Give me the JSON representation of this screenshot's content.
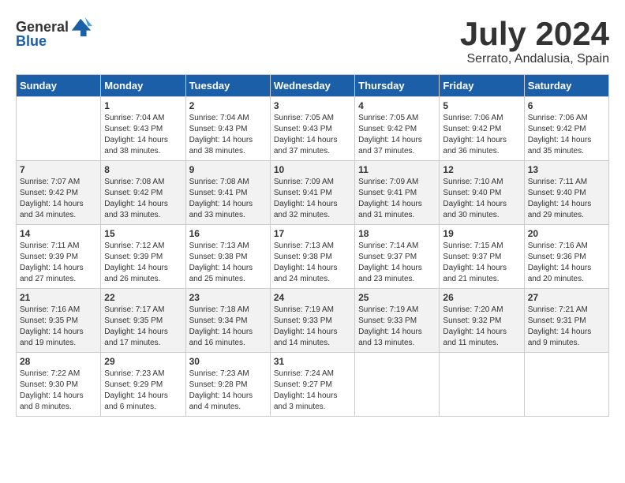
{
  "header": {
    "logo_general": "General",
    "logo_blue": "Blue",
    "month_year": "July 2024",
    "location": "Serrato, Andalusia, Spain"
  },
  "days_of_week": [
    "Sunday",
    "Monday",
    "Tuesday",
    "Wednesday",
    "Thursday",
    "Friday",
    "Saturday"
  ],
  "weeks": [
    [
      {
        "day": "",
        "sunrise": "",
        "sunset": "",
        "daylight": ""
      },
      {
        "day": "1",
        "sunrise": "Sunrise: 7:04 AM",
        "sunset": "Sunset: 9:43 PM",
        "daylight": "Daylight: 14 hours and 38 minutes."
      },
      {
        "day": "2",
        "sunrise": "Sunrise: 7:04 AM",
        "sunset": "Sunset: 9:43 PM",
        "daylight": "Daylight: 14 hours and 38 minutes."
      },
      {
        "day": "3",
        "sunrise": "Sunrise: 7:05 AM",
        "sunset": "Sunset: 9:43 PM",
        "daylight": "Daylight: 14 hours and 37 minutes."
      },
      {
        "day": "4",
        "sunrise": "Sunrise: 7:05 AM",
        "sunset": "Sunset: 9:42 PM",
        "daylight": "Daylight: 14 hours and 37 minutes."
      },
      {
        "day": "5",
        "sunrise": "Sunrise: 7:06 AM",
        "sunset": "Sunset: 9:42 PM",
        "daylight": "Daylight: 14 hours and 36 minutes."
      },
      {
        "day": "6",
        "sunrise": "Sunrise: 7:06 AM",
        "sunset": "Sunset: 9:42 PM",
        "daylight": "Daylight: 14 hours and 35 minutes."
      }
    ],
    [
      {
        "day": "7",
        "sunrise": "Sunrise: 7:07 AM",
        "sunset": "Sunset: 9:42 PM",
        "daylight": "Daylight: 14 hours and 34 minutes."
      },
      {
        "day": "8",
        "sunrise": "Sunrise: 7:08 AM",
        "sunset": "Sunset: 9:42 PM",
        "daylight": "Daylight: 14 hours and 33 minutes."
      },
      {
        "day": "9",
        "sunrise": "Sunrise: 7:08 AM",
        "sunset": "Sunset: 9:41 PM",
        "daylight": "Daylight: 14 hours and 33 minutes."
      },
      {
        "day": "10",
        "sunrise": "Sunrise: 7:09 AM",
        "sunset": "Sunset: 9:41 PM",
        "daylight": "Daylight: 14 hours and 32 minutes."
      },
      {
        "day": "11",
        "sunrise": "Sunrise: 7:09 AM",
        "sunset": "Sunset: 9:41 PM",
        "daylight": "Daylight: 14 hours and 31 minutes."
      },
      {
        "day": "12",
        "sunrise": "Sunrise: 7:10 AM",
        "sunset": "Sunset: 9:40 PM",
        "daylight": "Daylight: 14 hours and 30 minutes."
      },
      {
        "day": "13",
        "sunrise": "Sunrise: 7:11 AM",
        "sunset": "Sunset: 9:40 PM",
        "daylight": "Daylight: 14 hours and 29 minutes."
      }
    ],
    [
      {
        "day": "14",
        "sunrise": "Sunrise: 7:11 AM",
        "sunset": "Sunset: 9:39 PM",
        "daylight": "Daylight: 14 hours and 27 minutes."
      },
      {
        "day": "15",
        "sunrise": "Sunrise: 7:12 AM",
        "sunset": "Sunset: 9:39 PM",
        "daylight": "Daylight: 14 hours and 26 minutes."
      },
      {
        "day": "16",
        "sunrise": "Sunrise: 7:13 AM",
        "sunset": "Sunset: 9:38 PM",
        "daylight": "Daylight: 14 hours and 25 minutes."
      },
      {
        "day": "17",
        "sunrise": "Sunrise: 7:13 AM",
        "sunset": "Sunset: 9:38 PM",
        "daylight": "Daylight: 14 hours and 24 minutes."
      },
      {
        "day": "18",
        "sunrise": "Sunrise: 7:14 AM",
        "sunset": "Sunset: 9:37 PM",
        "daylight": "Daylight: 14 hours and 23 minutes."
      },
      {
        "day": "19",
        "sunrise": "Sunrise: 7:15 AM",
        "sunset": "Sunset: 9:37 PM",
        "daylight": "Daylight: 14 hours and 21 minutes."
      },
      {
        "day": "20",
        "sunrise": "Sunrise: 7:16 AM",
        "sunset": "Sunset: 9:36 PM",
        "daylight": "Daylight: 14 hours and 20 minutes."
      }
    ],
    [
      {
        "day": "21",
        "sunrise": "Sunrise: 7:16 AM",
        "sunset": "Sunset: 9:35 PM",
        "daylight": "Daylight: 14 hours and 19 minutes."
      },
      {
        "day": "22",
        "sunrise": "Sunrise: 7:17 AM",
        "sunset": "Sunset: 9:35 PM",
        "daylight": "Daylight: 14 hours and 17 minutes."
      },
      {
        "day": "23",
        "sunrise": "Sunrise: 7:18 AM",
        "sunset": "Sunset: 9:34 PM",
        "daylight": "Daylight: 14 hours and 16 minutes."
      },
      {
        "day": "24",
        "sunrise": "Sunrise: 7:19 AM",
        "sunset": "Sunset: 9:33 PM",
        "daylight": "Daylight: 14 hours and 14 minutes."
      },
      {
        "day": "25",
        "sunrise": "Sunrise: 7:19 AM",
        "sunset": "Sunset: 9:33 PM",
        "daylight": "Daylight: 14 hours and 13 minutes."
      },
      {
        "day": "26",
        "sunrise": "Sunrise: 7:20 AM",
        "sunset": "Sunset: 9:32 PM",
        "daylight": "Daylight: 14 hours and 11 minutes."
      },
      {
        "day": "27",
        "sunrise": "Sunrise: 7:21 AM",
        "sunset": "Sunset: 9:31 PM",
        "daylight": "Daylight: 14 hours and 9 minutes."
      }
    ],
    [
      {
        "day": "28",
        "sunrise": "Sunrise: 7:22 AM",
        "sunset": "Sunset: 9:30 PM",
        "daylight": "Daylight: 14 hours and 8 minutes."
      },
      {
        "day": "29",
        "sunrise": "Sunrise: 7:23 AM",
        "sunset": "Sunset: 9:29 PM",
        "daylight": "Daylight: 14 hours and 6 minutes."
      },
      {
        "day": "30",
        "sunrise": "Sunrise: 7:23 AM",
        "sunset": "Sunset: 9:28 PM",
        "daylight": "Daylight: 14 hours and 4 minutes."
      },
      {
        "day": "31",
        "sunrise": "Sunrise: 7:24 AM",
        "sunset": "Sunset: 9:27 PM",
        "daylight": "Daylight: 14 hours and 3 minutes."
      },
      {
        "day": "",
        "sunrise": "",
        "sunset": "",
        "daylight": ""
      },
      {
        "day": "",
        "sunrise": "",
        "sunset": "",
        "daylight": ""
      },
      {
        "day": "",
        "sunrise": "",
        "sunset": "",
        "daylight": ""
      }
    ]
  ]
}
